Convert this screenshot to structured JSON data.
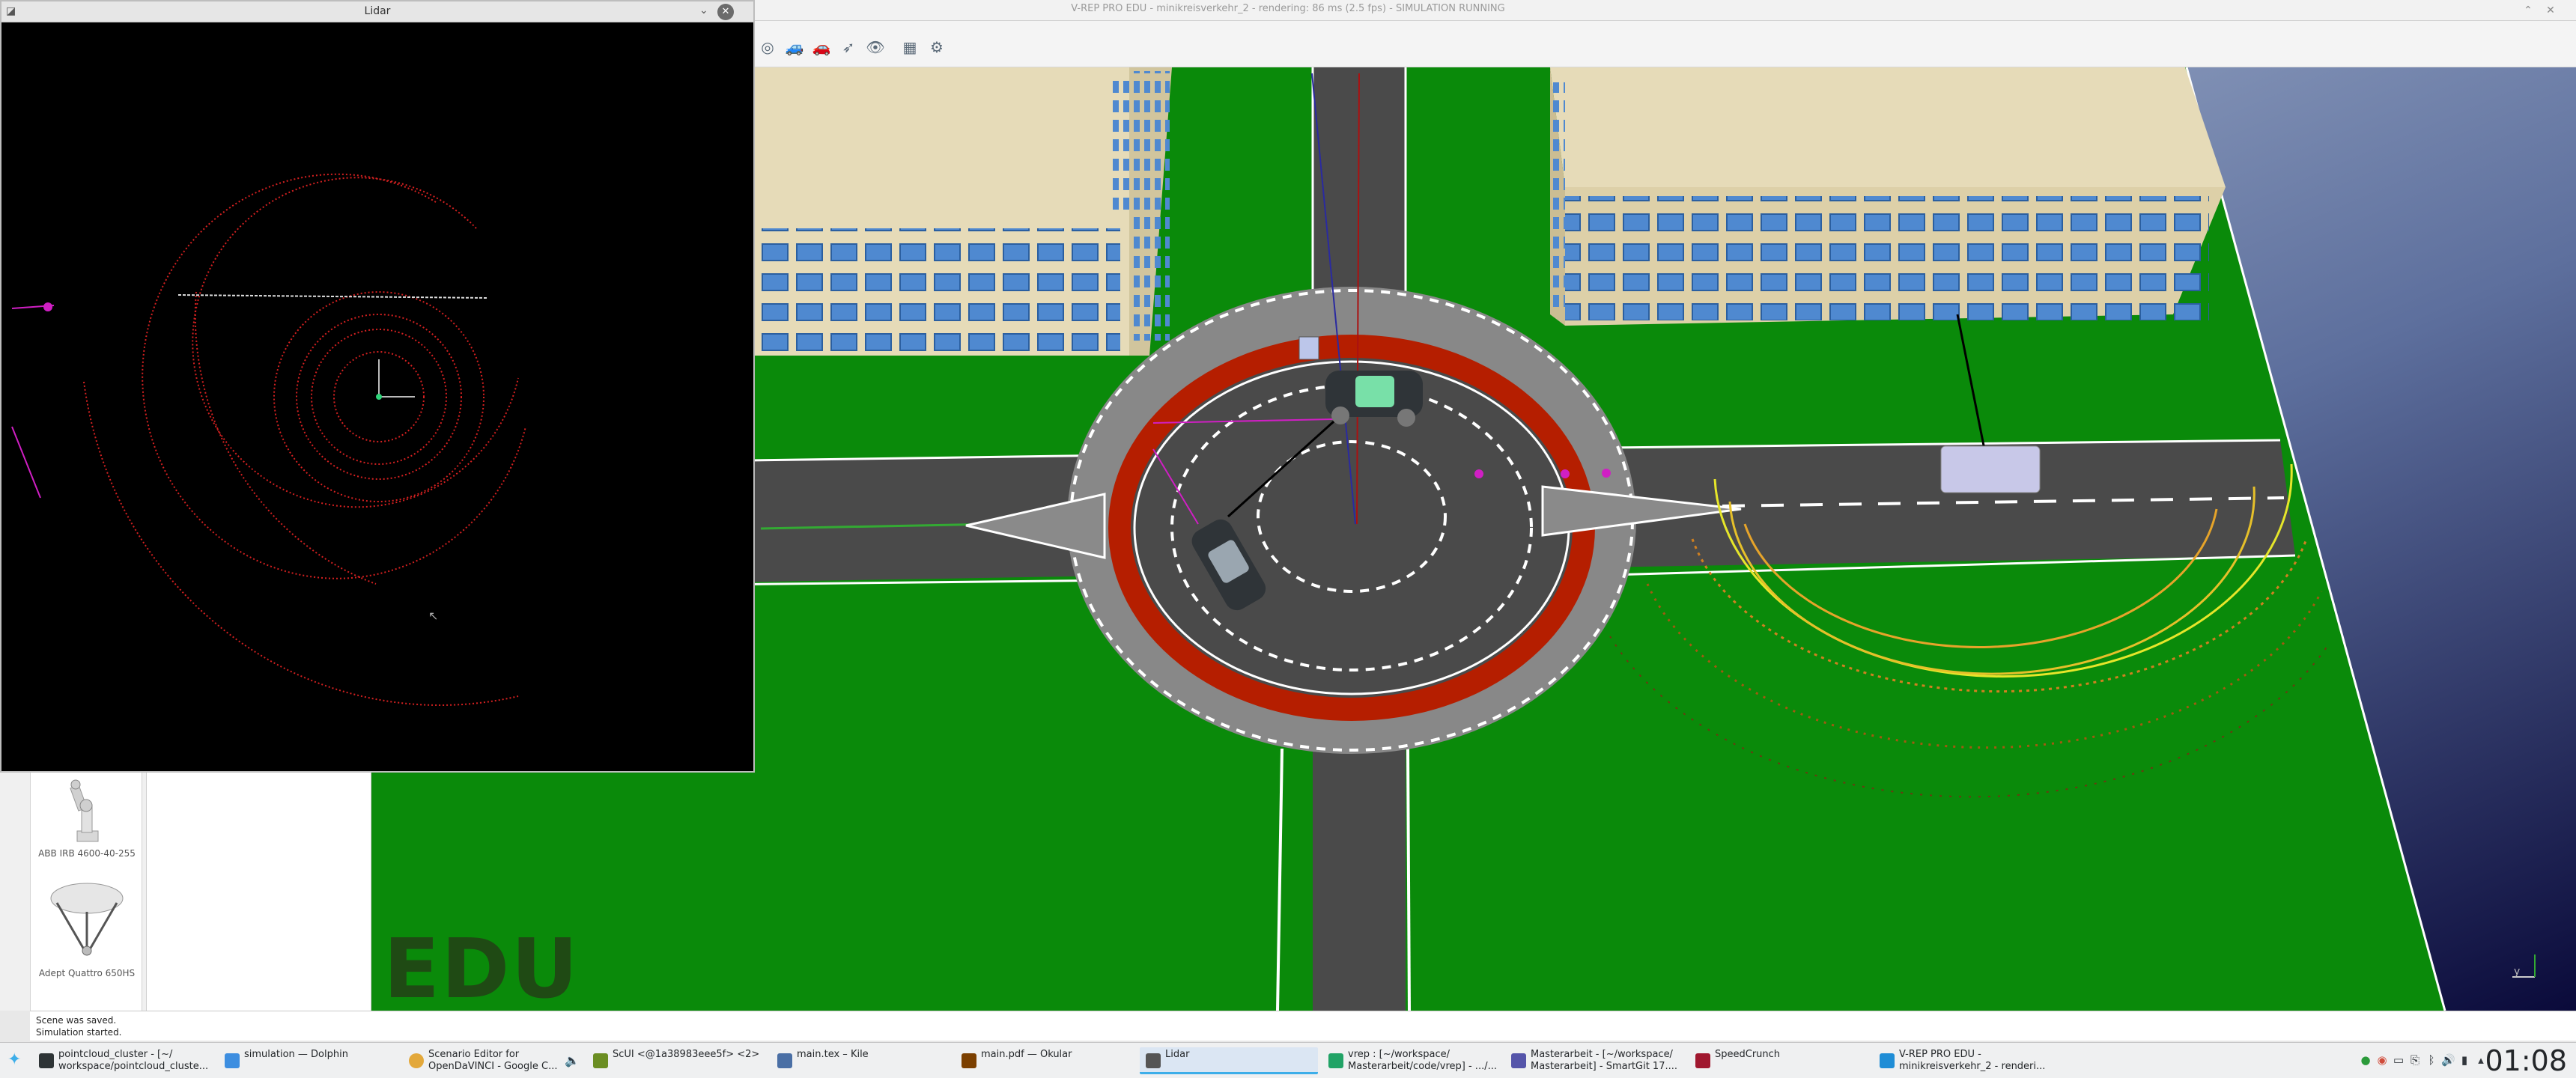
{
  "vrep": {
    "title": "V-REP PRO EDU - minikreisverkehr_2 - rendering: 86 ms (2.5 fps) - SIMULATION RUNNING",
    "toolbar_icons": [
      "selection-icon",
      "vehicle-icon",
      "vehicle-alt-icon",
      "rocket-icon",
      "eye-icon",
      "grid-icon",
      "robot-icon"
    ],
    "watermark": "EDU",
    "axis_y_label": "y"
  },
  "model_browser": {
    "items": [
      {
        "label": "ABB IRB 4600-40-255",
        "icon": "industrial-arm-icon"
      },
      {
        "label": "Adept Quattro 650HS",
        "icon": "delta-robot-icon"
      }
    ]
  },
  "status": {
    "lines": [
      "Scene was saved.",
      "Simulation started."
    ]
  },
  "lidar_window": {
    "title": "Lidar"
  },
  "taskbar": {
    "tasks": [
      {
        "label": "pointcloud_cluster - [~/\nworkspace/pointcloud_cluste...",
        "icon": "terminal-icon",
        "color": "#2e3436"
      },
      {
        "label": "simulation — Dolphin",
        "icon": "folder-icon",
        "color": "#3d8ee0"
      },
      {
        "label": "Scenario Editor for\nOpenDaVINCI - Google C...",
        "icon": "chrome-icon",
        "color": "#e3a83a"
      },
      {
        "label": "ScUI <@1a38983eee5f> <2>",
        "icon": "app-icon",
        "color": "#6b8e23"
      },
      {
        "label": "main.tex – Kile",
        "icon": "document-icon",
        "color": "#4a6fa5"
      },
      {
        "label": "main.pdf — Okular",
        "icon": "pdf-icon",
        "color": "#7b3f00"
      },
      {
        "label": "Lidar",
        "icon": "window-icon",
        "color": "#555555"
      },
      {
        "label": "vrep : [~/workspace/\nMasterarbeit/code/vrep] - .../...",
        "icon": "pycharm-icon",
        "color": "#21a366"
      },
      {
        "label": "Masterarbeit - [~/workspace/\nMasterarbeit] - SmartGit 17....",
        "icon": "git-icon",
        "color": "#5555aa"
      },
      {
        "label": "SpeedCrunch",
        "icon": "calculator-icon",
        "color": "#a0182f"
      },
      {
        "label": "V-REP PRO EDU -\nminikreisverkehr_2 - renderi...",
        "icon": "vrep-icon",
        "color": "#1f8dd6"
      }
    ],
    "clock": "01:08",
    "tray_icons": [
      "network-icon",
      "chrome-tray-icon",
      "display-icon",
      "clipboard-icon",
      "bluetooth-icon",
      "volume-icon",
      "battery-icon",
      "arrow-up-icon"
    ]
  }
}
